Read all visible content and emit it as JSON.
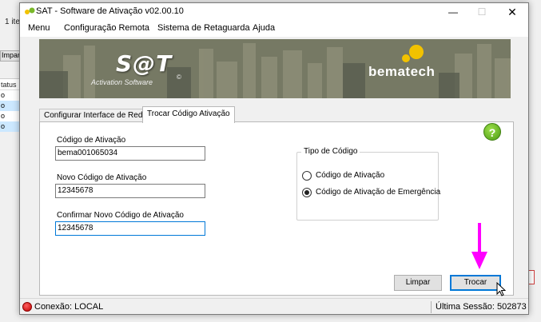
{
  "background_app": {
    "top_text": "1 ite",
    "button_label": "Impar",
    "list_header": "tatus",
    "list_rows": [
      "o",
      "o",
      "o",
      "o"
    ]
  },
  "window": {
    "title": "SAT - Software de Ativação v02.00.10",
    "controls": {
      "minimize": "—",
      "maximize": "☐",
      "close": "✕"
    }
  },
  "menu": {
    "items": [
      "Menu",
      "Configuração Remota",
      "Sistema de Retaguarda",
      "Ajuda"
    ]
  },
  "banner": {
    "logo_text": "S@T",
    "logo_subtitle": "Activation Software",
    "logo_registered": "©",
    "brand_text": "bematech"
  },
  "tabs": [
    "Configurar Interface de Rede",
    "Trocar Código Ativação"
  ],
  "active_tab": "Trocar Código Ativação",
  "help_button": "?",
  "form": {
    "current_code": {
      "label": "Código de Ativação",
      "value": "bema001065034"
    },
    "new_code": {
      "label": "Novo Código de Ativação",
      "value": "12345678"
    },
    "confirm_code": {
      "label": "Confirmar Novo Código de Ativação",
      "value": "12345678"
    }
  },
  "code_type": {
    "title": "Tipo de Código",
    "options": [
      {
        "label": "Código de Ativação",
        "checked": false
      },
      {
        "label": "Código de Ativação de Emergência",
        "checked": true
      }
    ]
  },
  "buttons": {
    "clear": "Limpar",
    "swap": "Trocar"
  },
  "status": {
    "connection": "Conexão: LOCAL",
    "last_session": "Última Sessão: 502873"
  },
  "colors": {
    "annotation_arrow": "#ff00ff",
    "status_connected": "#c00000",
    "help": "#4a9a12"
  }
}
